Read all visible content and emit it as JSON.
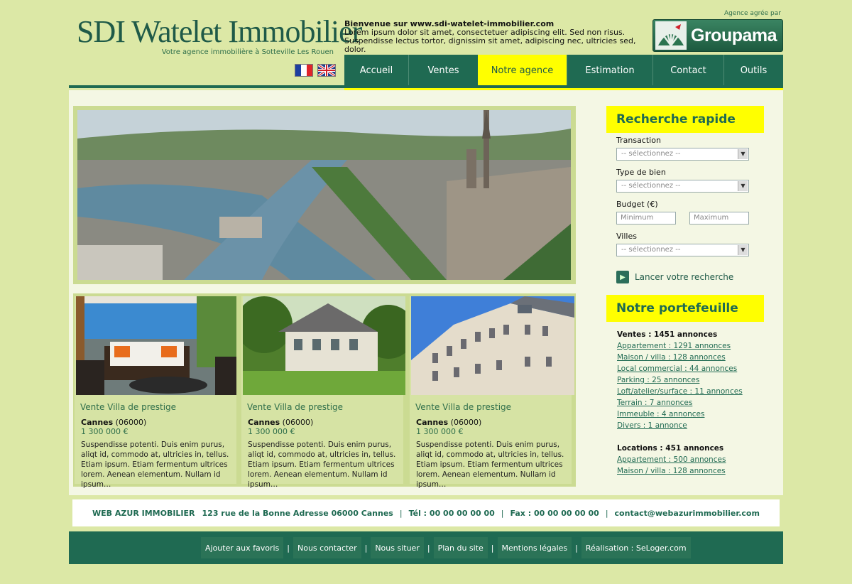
{
  "header": {
    "logo": "SDI Watelet Immobilier",
    "tagline": "Votre agence immobilière à Sotteville Les Rouen",
    "welcome_title": "Bienvenue sur www.sdi-watelet-immobilier.com",
    "welcome_text": "Lorem ipsum dolor sit amet, consectetuer adipiscing elit. Sed non risus. Suspendisse lectus tortor, dignissim sit amet, adipiscing nec, ultricies sed, dolor.",
    "agree_label": "Agence agrée par",
    "partner": "Groupama",
    "flags": [
      "flag-fr-icon",
      "flag-uk-icon"
    ]
  },
  "nav": [
    {
      "label": "Accueil"
    },
    {
      "label": "Ventes"
    },
    {
      "label": "Notre agence",
      "active": true
    },
    {
      "label": "Estimation"
    },
    {
      "label": "Contact"
    },
    {
      "label": "Outils"
    }
  ],
  "listings": [
    {
      "title": "Vente Villa de prestige",
      "city": "Cannes",
      "zip": "(06000)",
      "price": "1 300 000 €",
      "desc": "Suspendisse potenti. Duis enim purus, aliqt id, commodo at, ultricies in, tellus. Etiam ipsum. Etiam fermentum ultrices lorem. Aenean elementum. Nullam id ipsum…"
    },
    {
      "title": "Vente Villa de prestige",
      "city": "Cannes",
      "zip": "(06000)",
      "price": "1 300 000 €",
      "desc": "Suspendisse potenti. Duis enim purus, aliqt id, commodo at, ultricies in, tellus. Etiam ipsum. Etiam fermentum ultrices lorem. Aenean elementum. Nullam id ipsum…"
    },
    {
      "title": "Vente Villa de prestige",
      "city": "Cannes",
      "zip": "(06000)",
      "price": "1 300 000 €",
      "desc": "Suspendisse potenti. Duis enim purus, aliqt id, commodo at, ultricies in, tellus. Etiam ipsum. Etiam fermentum ultrices lorem. Aenean elementum. Nullam id ipsum…"
    }
  ],
  "search": {
    "title": "Recherche rapide",
    "transaction_label": "Transaction",
    "type_label": "Type de bien",
    "budget_label": "Budget (€)",
    "villes_label": "Villes",
    "select_placeholder": "-- sélectionnez --",
    "min_placeholder": "Minimum",
    "max_placeholder": "Maximum",
    "launch_label": "Lancer votre recherche"
  },
  "portfolio": {
    "title": "Notre portefeuille",
    "sales_head": "Ventes : 1451 annonces",
    "sales": [
      "Appartement : 1291 annonces",
      "Maison / villa : 128 annonces",
      "Local commercial : 44 annonces",
      "Parking : 25 annonces",
      "Loft/atelier/surface : 11 annonces",
      "Terrain : 7 annonces",
      "Immeuble : 4 annonces",
      "Divers : 1 annonce"
    ],
    "rent_head": "Locations : 451 annonces",
    "rent": [
      "Appartement : 500 annonces",
      "Maison / villa : 128 annonces"
    ]
  },
  "address": {
    "company": "WEB AZUR IMMOBILIER",
    "street": "123 rue de la Bonne Adresse 06000 Cannes",
    "sep": "|",
    "tel": "Tél : 00 00 00 00 00",
    "fax": "Fax : 00 00 00 00 00",
    "email": "contact@webazurimmobilier.com"
  },
  "footer": {
    "links": [
      "Ajouter aux favoris",
      "Nous contacter",
      "Nous situer",
      "Plan du site",
      "Mentions légales",
      "Réalisation : SeLoger.com"
    ],
    "sep": "|"
  },
  "colors": {
    "accent": "#1f6a52",
    "highlight": "#ffff00",
    "background": "#dce8a6"
  }
}
